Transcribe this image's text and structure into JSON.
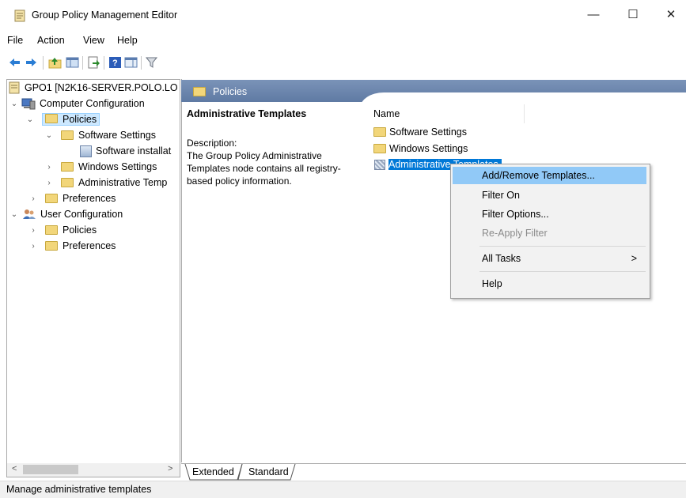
{
  "window": {
    "title": "Group Policy Management Editor",
    "minimize_glyph": "—",
    "maximize_glyph": "☐",
    "close_glyph": "✕"
  },
  "menu": [
    "File",
    "Action",
    "View",
    "Help"
  ],
  "toolbar": {
    "icons": [
      "back-arrow-icon",
      "forward-arrow-icon",
      "up-folder-icon",
      "show-hide-tree-icon",
      "export-list-icon",
      "help-icon",
      "action-pane-icon",
      "filter-icon"
    ]
  },
  "tree": {
    "items": [
      {
        "label": "GPO1 [N2K16-SERVER.POLO.LO",
        "level": 0,
        "expander": ""
      },
      {
        "label": "Computer Configuration",
        "level": 1,
        "expander": "expanded"
      },
      {
        "label": "Policies",
        "level": 2,
        "expander": "expanded",
        "selected": true
      },
      {
        "label": "Software Settings",
        "level": 3,
        "expander": "expanded"
      },
      {
        "label": "Software installat",
        "level": 4,
        "expander": ""
      },
      {
        "label": "Windows Settings",
        "level": 3,
        "expander": "collapsed"
      },
      {
        "label": "Administrative Temp",
        "level": 3,
        "expander": "collapsed"
      },
      {
        "label": "Preferences",
        "level": 2,
        "expander": "collapsed"
      },
      {
        "label": "User Configuration",
        "level": 1,
        "expander": "expanded"
      },
      {
        "label": "Policies",
        "level": 2,
        "expander": "collapsed"
      },
      {
        "label": "Preferences",
        "level": 2,
        "expander": "collapsed"
      }
    ],
    "scroll_left": "<",
    "scroll_right": ">"
  },
  "details": {
    "header": "Policies",
    "selected_title": "Administrative Templates",
    "description_label": "Description:",
    "description_text": "The Group Policy Administrative Templates node contains all registry-based policy information.",
    "column_name": "Name",
    "items": [
      {
        "label": "Software Settings",
        "icon": "folder"
      },
      {
        "label": "Windows Settings",
        "icon": "folder"
      },
      {
        "label": "Administrative Templates",
        "icon": "admin-templates",
        "selected": true
      }
    ]
  },
  "context_menu": {
    "items": [
      {
        "label": "Add/Remove Templates...",
        "highlighted": true
      },
      {
        "label": "Filter On"
      },
      {
        "label": "Filter Options..."
      },
      {
        "label": "Re-Apply Filter",
        "disabled": true
      },
      {
        "label": "All Tasks",
        "submenu_arrow": ">"
      },
      {
        "label": "Help"
      }
    ]
  },
  "tabs": [
    "Extended",
    "Standard"
  ],
  "status": "Manage administrative templates",
  "colors": {
    "selection_blue": "#0078d7",
    "menu_highlight": "#91c9f7",
    "header_bar": "#6b86ad"
  }
}
